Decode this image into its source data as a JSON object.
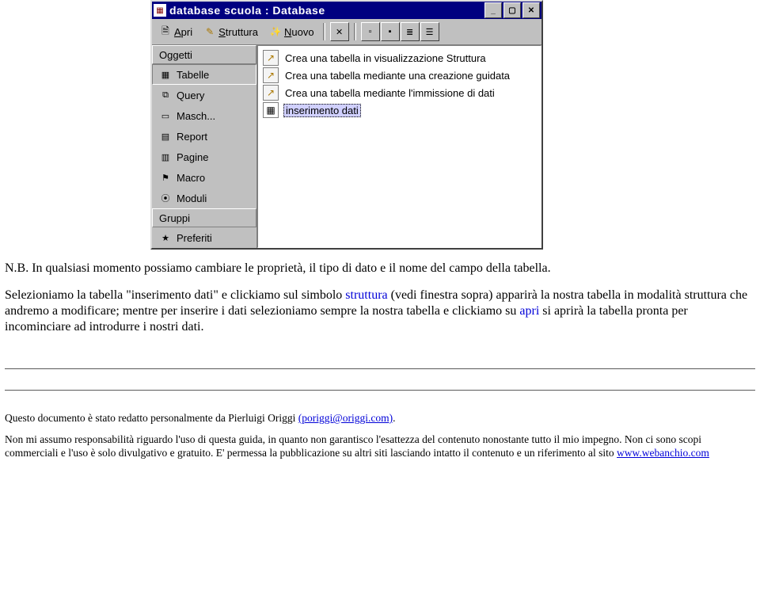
{
  "window": {
    "title": "database scuola : Database"
  },
  "toolbar": {
    "apri": "Apri",
    "struttura": "Struttura",
    "nuovo": "Nuovo"
  },
  "sidebar": {
    "header_oggetti": "Oggetti",
    "items": {
      "tabelle": "Tabelle",
      "query": "Query",
      "masch": "Masch...",
      "report": "Report",
      "pagine": "Pagine",
      "macro": "Macro",
      "moduli": "Moduli"
    },
    "header_gruppi": "Gruppi",
    "preferiti": "Preferiti"
  },
  "content": {
    "items": [
      "Crea una tabella in visualizzazione Struttura",
      "Crea una tabella mediante una creazione guidata",
      "Crea una tabella mediante l'immissione di dati"
    ],
    "selected": "inserimento dati"
  },
  "para": {
    "t1": "N.B. In qualsiasi momento possiamo cambiare le proprietà, il tipo di dato e il nome del campo della tabella.",
    "t2a": "Selezioniamo la tabella \"inserimento dati\" e clickiamo sul simbolo ",
    "t2_link1": "struttura",
    "t2b": " (vedi finestra sopra) apparirà la nostra tabella in modalità struttura che andremo a modificare; mentre per inserire i dati selezioniamo sempre la nostra tabella e clickiamo su ",
    "t2_link2": "apri",
    "t2c": " si aprirà la tabella pronta per incominciare ad introdurre i nostri dati."
  },
  "footer": {
    "t1a": "Questo documento è stato redatto personalmente da Pierluigi Origgi ",
    "t1_link": "(poriggi@origgi.com)",
    "t1b": ".",
    "t2a": "Non  mi assumo responsabilità  riguardo l'uso di questa guida, in quanto non garantisco l'esattezza del contenuto nonostante tutto il mio impegno. Non ci sono scopi commerciali e l'uso è solo divulgativo e gratuito. E' permessa la pubblicazione su altri siti lasciando intatto il contenuto e un riferimento al sito ",
    "t2_link": "www.webanchio.com"
  }
}
